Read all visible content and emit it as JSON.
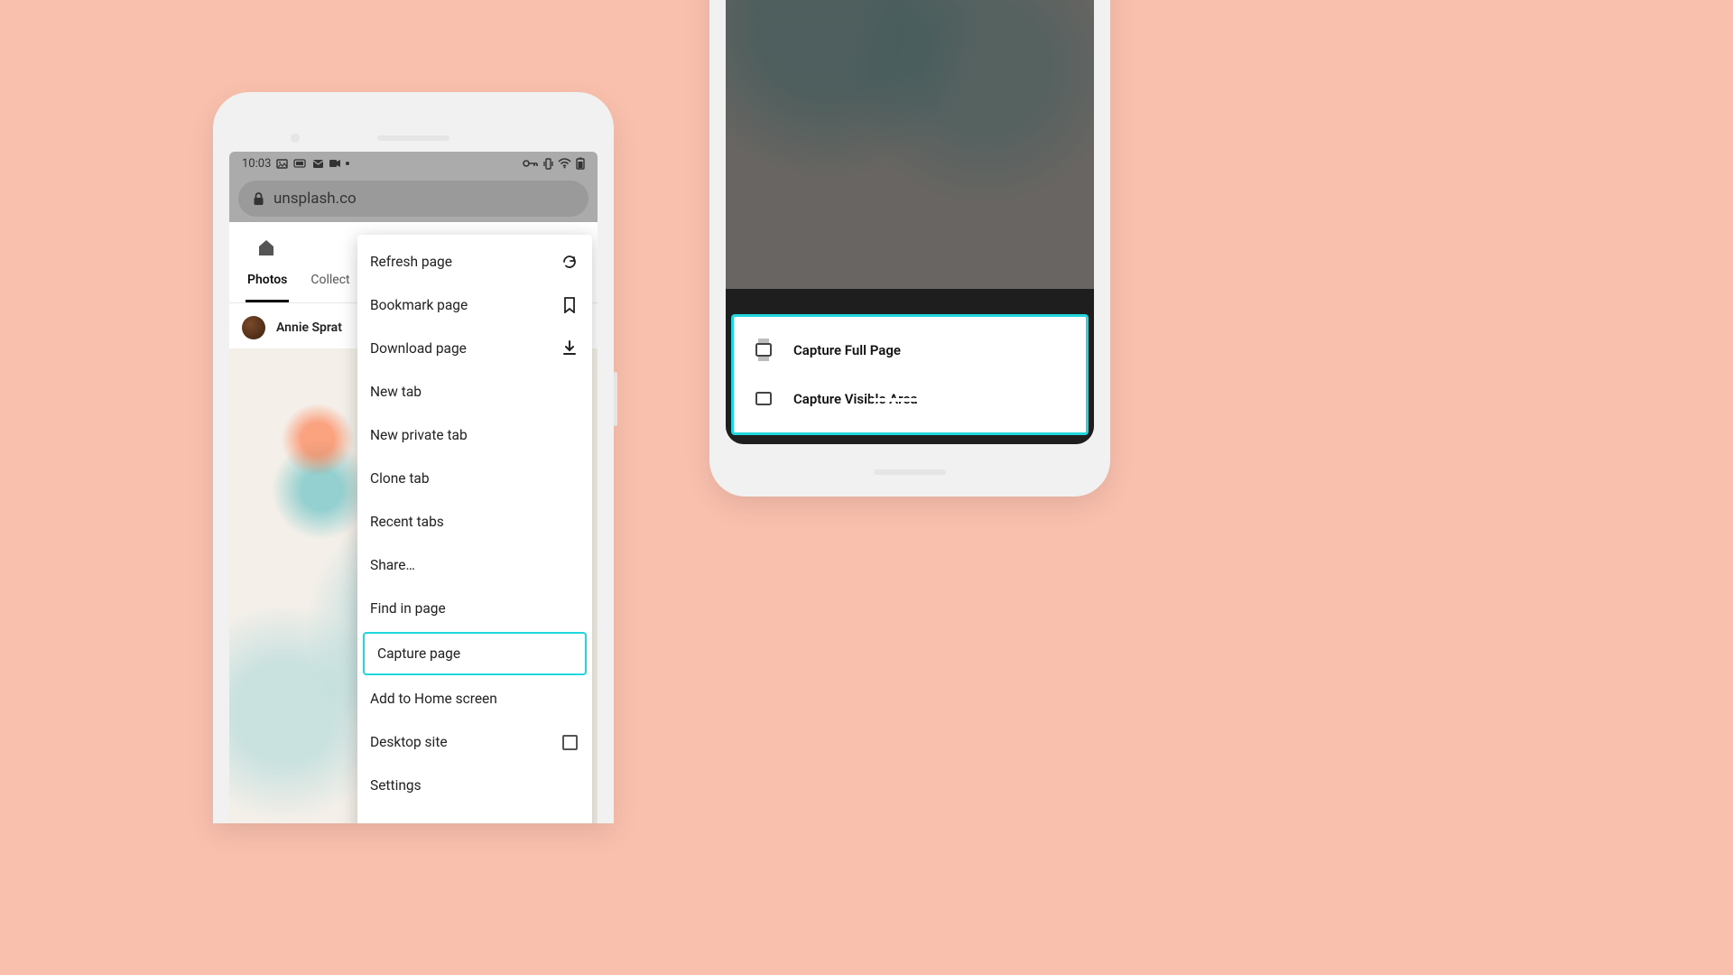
{
  "status": {
    "time": "10:03"
  },
  "url": "unsplash.co",
  "tabs": {
    "photos": "Photos",
    "collections": "Collect"
  },
  "author": "Annie Sprat",
  "menu": {
    "refresh": "Refresh page",
    "bookmark": "Bookmark page",
    "download": "Download page",
    "newtab": "New tab",
    "private": "New private tab",
    "clone": "Clone tab",
    "recent": "Recent tabs",
    "share": "Share…",
    "find": "Find in page",
    "capture": "Capture page",
    "home": "Add to Home screen",
    "desktop": "Desktop site",
    "settings": "Settings"
  },
  "sheet": {
    "full": "Capture Full Page",
    "visible": "Capture Visible Area"
  },
  "highlight_color": "#22d6de"
}
